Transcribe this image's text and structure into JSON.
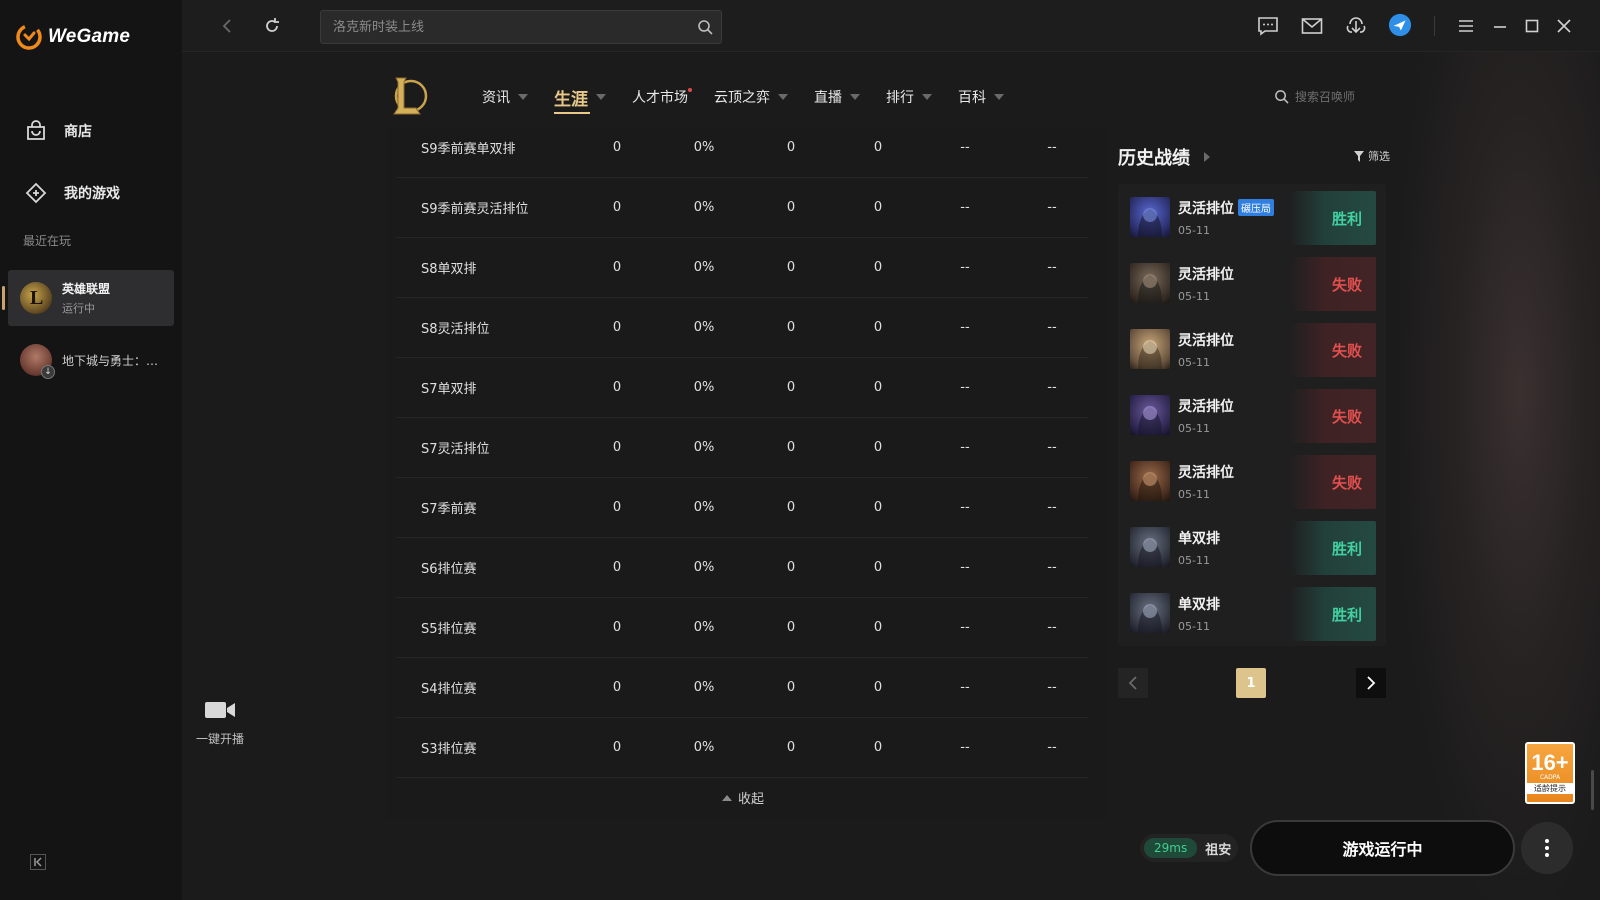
{
  "app": {
    "name": "WeGame"
  },
  "sidebar": {
    "items": [
      {
        "label": "商店",
        "icon": "bag-icon"
      },
      {
        "label": "我的游戏",
        "icon": "gamepad-icon"
      }
    ],
    "recent_label": "最近在玩",
    "recent": [
      {
        "title": "英雄联盟",
        "status": "运行中"
      },
      {
        "title": "地下城与勇士：创新世纪"
      }
    ]
  },
  "topbar": {
    "search_placeholder": "洛克新时装上线"
  },
  "game_nav": {
    "tabs": [
      {
        "label": "资讯",
        "caret": true,
        "dot": false
      },
      {
        "label": "生涯",
        "caret": true,
        "dot": false,
        "active": true
      },
      {
        "label": "人才市场",
        "caret": false,
        "dot": true
      },
      {
        "label": "云顶之弈",
        "caret": true,
        "dot": false
      },
      {
        "label": "直播",
        "caret": true,
        "dot": false
      },
      {
        "label": "排行",
        "caret": true,
        "dot": false
      },
      {
        "label": "百科",
        "caret": true,
        "dot": false
      }
    ],
    "summoner_search_placeholder": "搜索召唤师"
  },
  "stats": {
    "rows": [
      {
        "name": "S9季前赛单双排",
        "c1": "0",
        "c2": "0%",
        "c3": "0",
        "c4": "0",
        "c5": "--",
        "c6": "--"
      },
      {
        "name": "S9季前赛灵活排位",
        "c1": "0",
        "c2": "0%",
        "c3": "0",
        "c4": "0",
        "c5": "--",
        "c6": "--"
      },
      {
        "name": "S8单双排",
        "c1": "0",
        "c2": "0%",
        "c3": "0",
        "c4": "0",
        "c5": "--",
        "c6": "--"
      },
      {
        "name": "S8灵活排位",
        "c1": "0",
        "c2": "0%",
        "c3": "0",
        "c4": "0",
        "c5": "--",
        "c6": "--"
      },
      {
        "name": "S7单双排",
        "c1": "0",
        "c2": "0%",
        "c3": "0",
        "c4": "0",
        "c5": "--",
        "c6": "--"
      },
      {
        "name": "S7灵活排位",
        "c1": "0",
        "c2": "0%",
        "c3": "0",
        "c4": "0",
        "c5": "--",
        "c6": "--"
      },
      {
        "name": "S7季前赛",
        "c1": "0",
        "c2": "0%",
        "c3": "0",
        "c4": "0",
        "c5": "--",
        "c6": "--"
      },
      {
        "name": "S6排位赛",
        "c1": "0",
        "c2": "0%",
        "c3": "0",
        "c4": "0",
        "c5": "--",
        "c6": "--"
      },
      {
        "name": "S5排位赛",
        "c1": "0",
        "c2": "0%",
        "c3": "0",
        "c4": "0",
        "c5": "--",
        "c6": "--"
      },
      {
        "name": "S4排位赛",
        "c1": "0",
        "c2": "0%",
        "c3": "0",
        "c4": "0",
        "c5": "--",
        "c6": "--"
      },
      {
        "name": "S3排位赛",
        "c1": "0",
        "c2": "0%",
        "c3": "0",
        "c4": "0",
        "c5": "--",
        "c6": "--"
      }
    ],
    "collapse_label": "收起"
  },
  "history": {
    "title": "历史战绩",
    "filter_label": "筛选",
    "matches": [
      {
        "mode": "灵活排位",
        "tag": "碾压局",
        "date": "05-11",
        "result": "胜利",
        "win": true,
        "color": "#3a4a8a"
      },
      {
        "mode": "灵活排位",
        "tag": "",
        "date": "05-11",
        "result": "失败",
        "win": false,
        "color": "#4a4038"
      },
      {
        "mode": "灵活排位",
        "tag": "",
        "date": "05-11",
        "result": "失败",
        "win": false,
        "color": "#6a5a48"
      },
      {
        "mode": "灵活排位",
        "tag": "",
        "date": "05-11",
        "result": "失败",
        "win": false,
        "color": "#3a3458"
      },
      {
        "mode": "灵活排位",
        "tag": "",
        "date": "05-11",
        "result": "失败",
        "win": false,
        "color": "#5a3a2a"
      },
      {
        "mode": "单双排",
        "tag": "",
        "date": "05-11",
        "result": "胜利",
        "win": true,
        "color": "#3a3e4a"
      },
      {
        "mode": "单双排",
        "tag": "",
        "date": "05-11",
        "result": "胜利",
        "win": true,
        "color": "#3a3e4a"
      }
    ],
    "page": "1"
  },
  "live": {
    "label": "一键开播"
  },
  "age_badge": {
    "age": "16+",
    "org": "CADPA",
    "text": "适龄提示"
  },
  "footer": {
    "ping": "29ms",
    "region": "祖安",
    "run_button": "游戏运行中"
  },
  "colors": {
    "accent": "#e9c98a",
    "win": "#42d0a0",
    "lose": "#e0504e",
    "tag": "#2f7ee0"
  }
}
